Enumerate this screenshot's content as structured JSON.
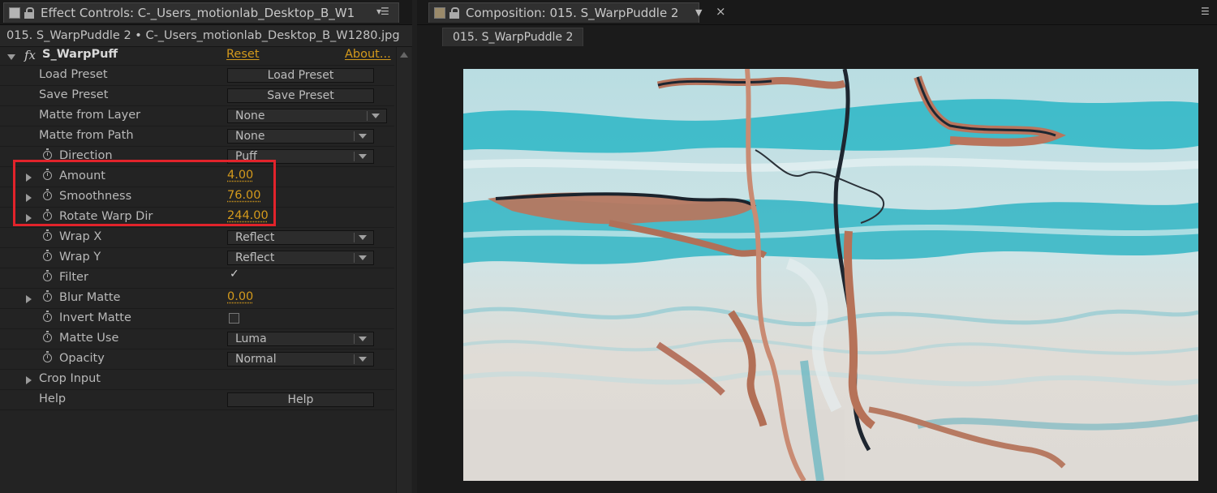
{
  "effect_controls": {
    "tab_title": "Effect Controls: C-_Users_motionlab_Desktop_B_W1",
    "menu_icon": "panel-menu-icon",
    "layer_path": "015. S_WarpPuddle 2 • C-_Users_motionlab_Desktop_B_W1280.jpg",
    "effect": {
      "fx_label": "fx",
      "name": "S_WarpPuff",
      "reset_label": "Reset",
      "about_label": "About..."
    },
    "rows": {
      "load_preset": {
        "label": "Load Preset",
        "button": "Load Preset"
      },
      "save_preset": {
        "label": "Save Preset",
        "button": "Save Preset"
      },
      "matte_from_layer": {
        "label": "Matte from Layer",
        "value": "None"
      },
      "matte_from_path": {
        "label": "Matte from Path",
        "value": "None"
      },
      "direction": {
        "label": "Direction",
        "value": "Puff"
      },
      "amount": {
        "label": "Amount",
        "value": "4.00"
      },
      "smoothness": {
        "label": "Smoothness",
        "value": "76.00"
      },
      "rotate_warp_dir": {
        "label": "Rotate Warp Dir",
        "value": "244.00"
      },
      "wrap_x": {
        "label": "Wrap X",
        "value": "Reflect"
      },
      "wrap_y": {
        "label": "Wrap Y",
        "value": "Reflect"
      },
      "filter": {
        "label": "Filter",
        "checked": true,
        "check_glyph": "✓"
      },
      "blur_matte": {
        "label": "Blur Matte",
        "value": "0.00"
      },
      "invert_matte": {
        "label": "Invert Matte",
        "checked": false
      },
      "matte_use": {
        "label": "Matte Use",
        "value": "Luma"
      },
      "opacity": {
        "label": "Opacity",
        "value": "Normal"
      },
      "crop_input": {
        "label": "Crop Input"
      },
      "help": {
        "label": "Help",
        "button": "Help"
      }
    }
  },
  "composition": {
    "tab_title": "Composition: 015. S_WarpPuddle 2",
    "close_glyph": "×",
    "sub_tab": "015. S_WarpPuddle 2",
    "colors": {
      "teal": "#21b3c4",
      "cream": "#e2ddd7",
      "copper": "#b4735a",
      "dark": "#1d2630"
    }
  },
  "annotation": {
    "highlight_color": "#e2232b"
  }
}
